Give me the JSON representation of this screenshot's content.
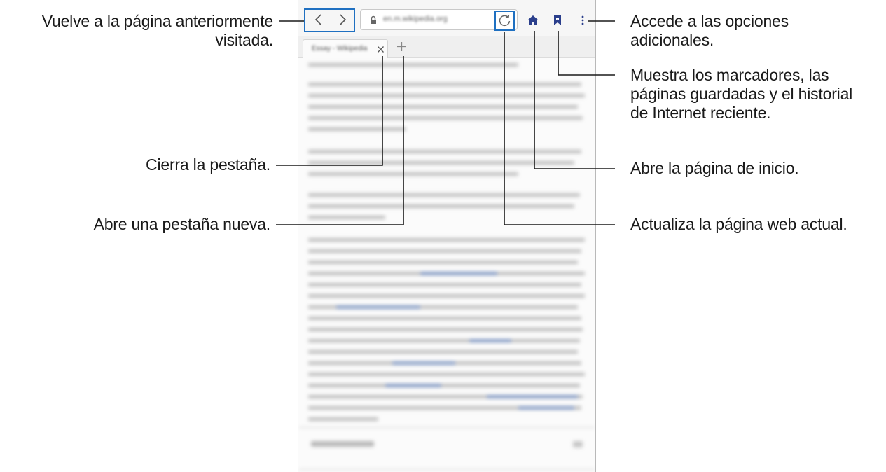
{
  "browser": {
    "url": "en.m.wikipedia.org",
    "tab_title": "Essay - Wikipedia",
    "close_tab_icon": "close-icon",
    "new_tab_icon": "plus-icon",
    "back_icon": "chevron-left-icon",
    "forward_icon": "chevron-right-icon",
    "lock_icon": "lock-icon",
    "refresh_icon": "refresh-icon",
    "home_icon": "home-icon",
    "bookmark_icon": "bookmark-icon",
    "more_icon": "more-vertical-icon"
  },
  "callouts": {
    "back_forward": [
      "Vuelve a la página anteriormente",
      "visitada."
    ],
    "close_tab": [
      "Cierra la pestaña."
    ],
    "new_tab": [
      "Abre una pestaña nueva."
    ],
    "more_options": [
      "Accede a las opciones",
      "adicionales."
    ],
    "bookmarks": [
      "Muestra los marcadores, las",
      "páginas guardadas y el historial",
      "de Internet reciente."
    ],
    "home": [
      "Abre la página de inicio."
    ],
    "refresh": [
      "Actualiza la página web actual."
    ]
  },
  "colors": {
    "highlight": "#1f70c1",
    "icon_accent": "#2b3f8c",
    "leader_line": "#1a1a1a"
  }
}
